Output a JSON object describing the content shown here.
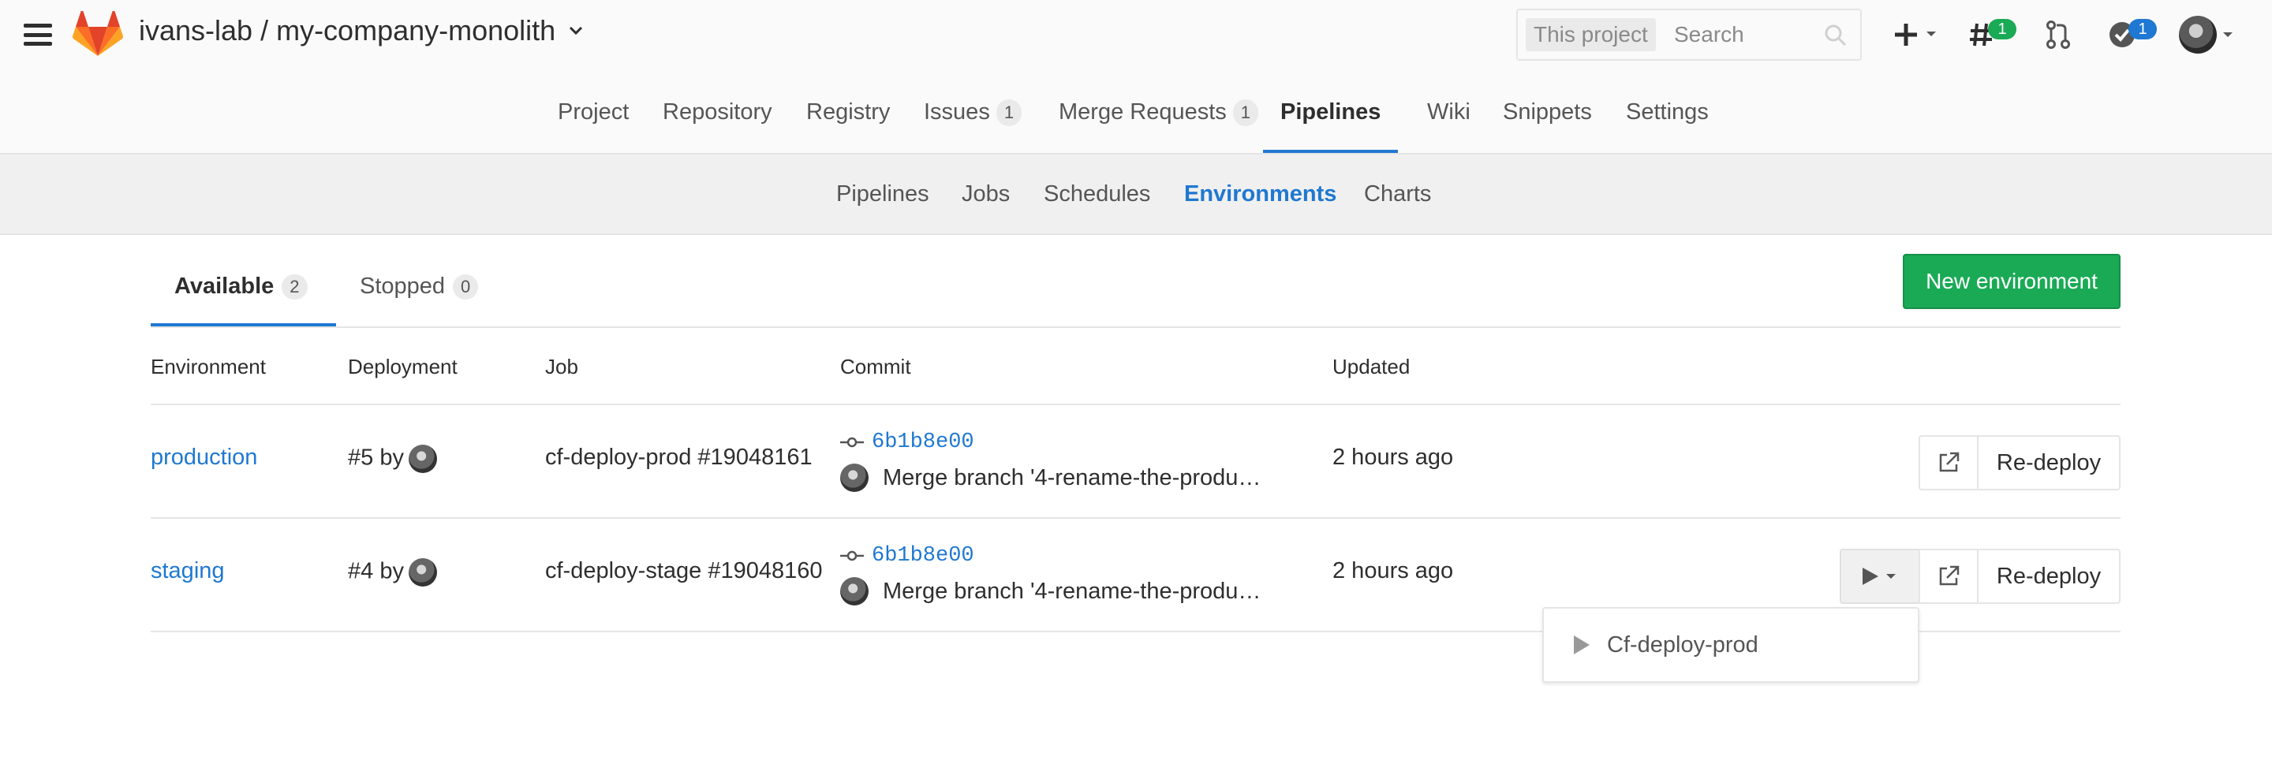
{
  "header": {
    "project_title": "ivans-lab / my-company-monolith",
    "search": {
      "scope": "This project",
      "placeholder": "Search"
    },
    "issues_badge": "1",
    "todos_badge": "1"
  },
  "nav": {
    "items": [
      {
        "label": "Project"
      },
      {
        "label": "Repository"
      },
      {
        "label": "Registry"
      },
      {
        "label": "Issues",
        "count": "1"
      },
      {
        "label": "Merge Requests",
        "count": "1"
      },
      {
        "label": "Pipelines",
        "active": true
      },
      {
        "label": "Wiki"
      },
      {
        "label": "Snippets"
      },
      {
        "label": "Settings"
      }
    ]
  },
  "subnav": {
    "items": [
      {
        "label": "Pipelines"
      },
      {
        "label": "Jobs"
      },
      {
        "label": "Schedules"
      },
      {
        "label": "Environments",
        "active": true
      },
      {
        "label": "Charts"
      }
    ]
  },
  "tabs": {
    "available": {
      "label": "Available",
      "count": "2"
    },
    "stopped": {
      "label": "Stopped",
      "count": "0"
    },
    "new_environment": "New environment"
  },
  "table": {
    "headers": {
      "environment": "Environment",
      "deployment": "Deployment",
      "job": "Job",
      "commit": "Commit",
      "updated": "Updated"
    },
    "rows": [
      {
        "environment": "production",
        "deployment": "#5 by",
        "job": "cf-deploy-prod #19048161",
        "commit_sha": "6b1b8e00",
        "commit_message": "Merge branch '4-rename-the-produ…",
        "updated": "2 hours ago",
        "redeploy": "Re-deploy"
      },
      {
        "environment": "staging",
        "deployment": "#4 by",
        "job": "cf-deploy-stage #19048160",
        "commit_sha": "6b1b8e00",
        "commit_message": "Merge branch '4-rename-the-produ…",
        "updated": "2 hours ago",
        "redeploy": "Re-deploy"
      }
    ]
  },
  "dropdown": {
    "items": [
      {
        "label": "Cf-deploy-prod"
      }
    ]
  },
  "colors": {
    "link": "#1f78d1",
    "success": "#1aaa55",
    "logo": "#e24329"
  }
}
